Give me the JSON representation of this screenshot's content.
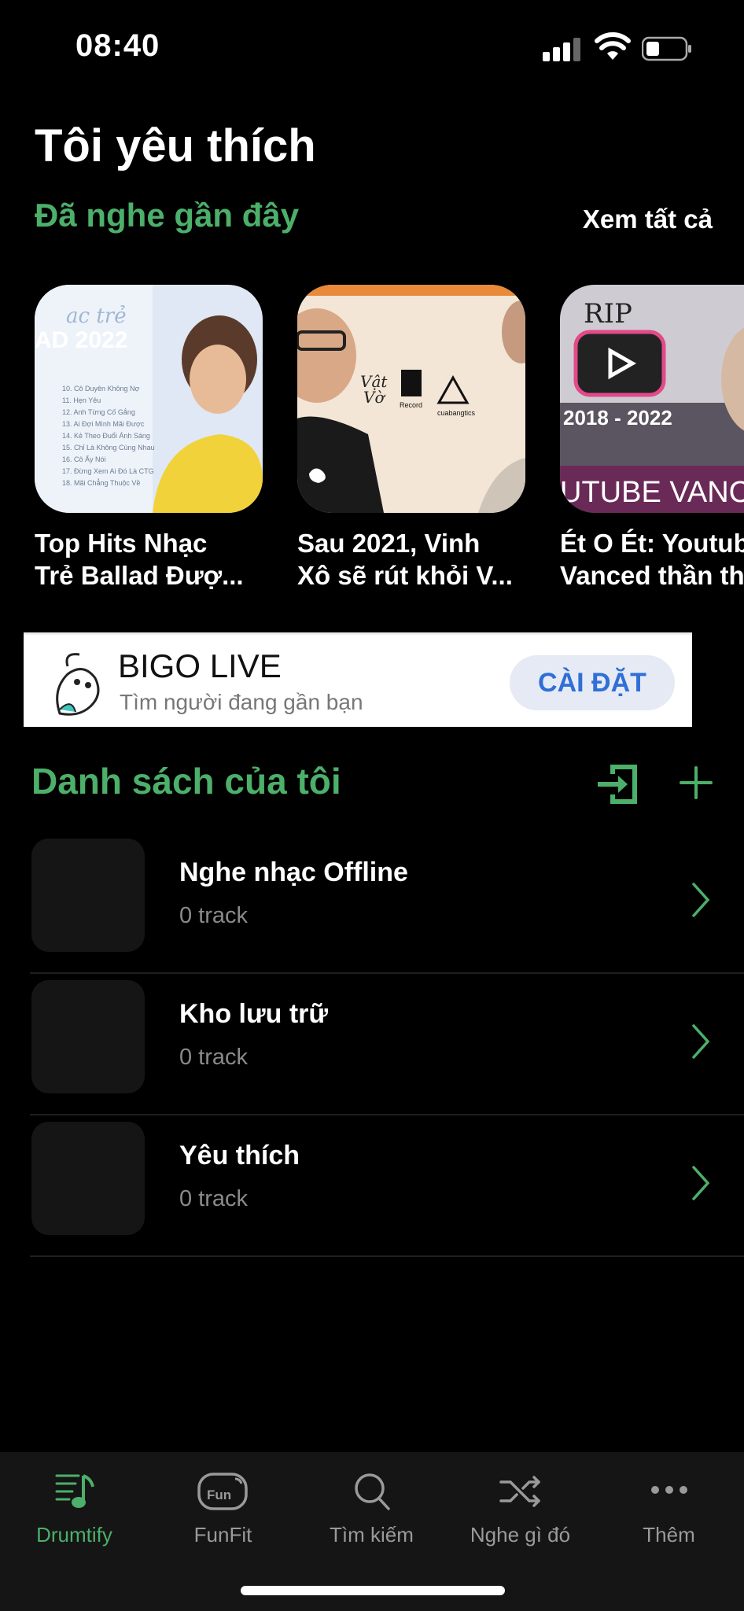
{
  "status_bar": {
    "time": "08:40"
  },
  "header": {
    "title": "Tôi yêu thích",
    "recent_section": "Đã nghe gần đây",
    "see_all": "Xem tất cả"
  },
  "recent_items": [
    {
      "title": "Top Hits Nhạc\nTrẻ Ballad Đượ..."
    },
    {
      "title": "Sau 2021, Vinh\nXô sẽ rút khỏi V..."
    },
    {
      "title": "Ét O Ét: Youtube\nVanced thần th..."
    }
  ],
  "ad": {
    "title": "BIGO LIVE",
    "subtitle": "Tìm người đang gần bạn",
    "button": "CÀI ĐẶT"
  },
  "my_list": {
    "title": "Danh sách của tôi",
    "items": [
      {
        "title": "Nghe nhạc Offline",
        "count": "0 track"
      },
      {
        "title": "Kho lưu trữ",
        "count": "0 track"
      },
      {
        "title": "Yêu thích",
        "count": "0 track"
      }
    ]
  },
  "tabs": [
    {
      "label": "Drumtify",
      "icon": "music-list-icon",
      "active": true
    },
    {
      "label": "FunFit",
      "icon": "funfit-icon",
      "active": false
    },
    {
      "label": "Tìm kiếm",
      "icon": "search-icon",
      "active": false
    },
    {
      "label": "Nghe gì đó",
      "icon": "shuffle-icon",
      "active": false
    },
    {
      "label": "Thêm",
      "icon": "more-icon",
      "active": false
    }
  ],
  "colors": {
    "accent": "#4caf6a",
    "background": "#000000",
    "ad_button": "#2f6fd6"
  }
}
